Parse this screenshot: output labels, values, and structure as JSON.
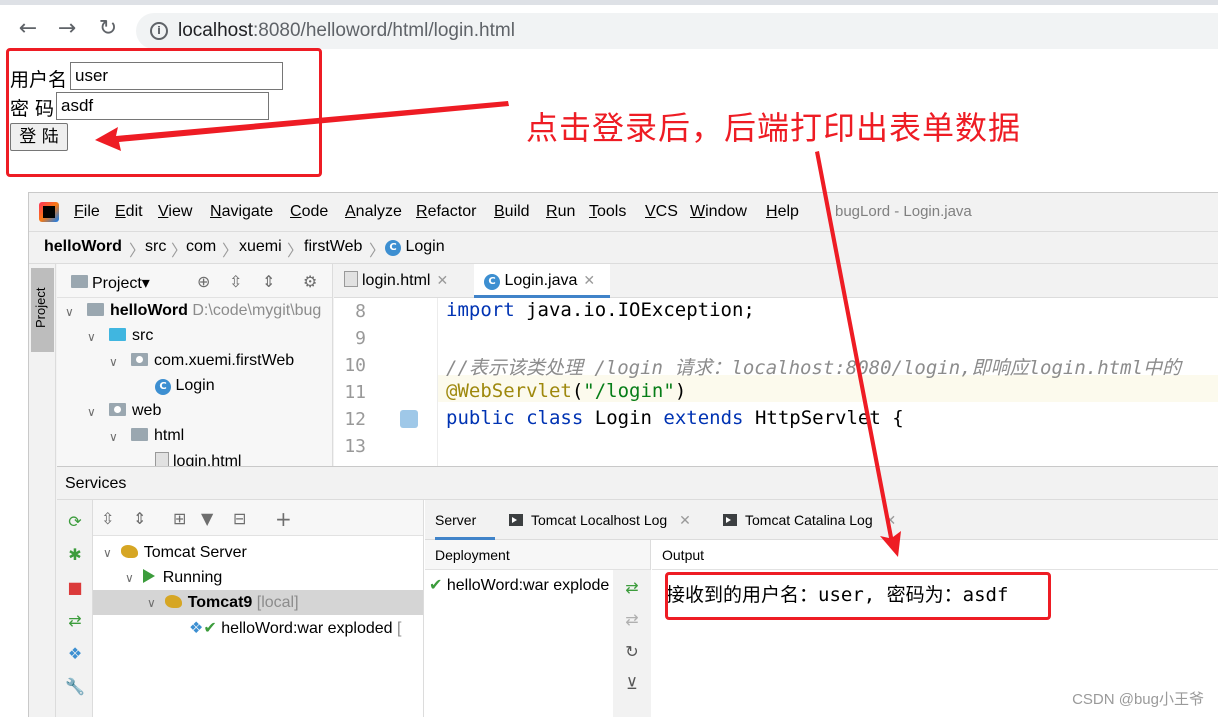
{
  "browser": {
    "url_host": "localhost",
    "url_path": ":8080/helloword/html/login.html",
    "back_icon": "back-arrow-icon",
    "forward_icon": "forward-arrow-icon",
    "reload_icon": "reload-icon"
  },
  "login_form": {
    "username_label": "用户名",
    "username_value": "user",
    "password_label": "密 码",
    "password_value": "asdf",
    "submit_label": "登 陆"
  },
  "annotation": {
    "text": "点击登录后，后端打印出表单数据",
    "color": "#ee1c24"
  },
  "ide": {
    "window_title": "bugLord - Login.java",
    "menu": [
      "File",
      "Edit",
      "View",
      "Navigate",
      "Code",
      "Analyze",
      "Refactor",
      "Build",
      "Run",
      "Tools",
      "VCS",
      "Window",
      "Help"
    ],
    "breadcrumb": [
      "helloWord",
      "src",
      "com",
      "xuemi",
      "firstWeb",
      "Login"
    ],
    "project_panel": {
      "tab_label": "Project",
      "toolbar_label": "Project▾",
      "tree": [
        {
          "label": "helloWord",
          "extra": "D:\\code\\mygit\\bug"
        },
        {
          "label": "src"
        },
        {
          "label": "com.xuemi.firstWeb"
        },
        {
          "label": "Login"
        },
        {
          "label": "web"
        },
        {
          "label": "html"
        },
        {
          "label": "login.html"
        }
      ]
    },
    "editor": {
      "tabs": [
        {
          "label": "login.html"
        },
        {
          "label": "Login.java",
          "active": true
        }
      ],
      "lines": [
        {
          "no": "8",
          "code": "import java.io.IOException;"
        },
        {
          "no": "9",
          "code": ""
        },
        {
          "no": "10",
          "code": "//表示该类处理 /login 请求：localhost:8080/login,即响应login.html中的"
        },
        {
          "no": "11",
          "code": "@WebServlet(\"/login\")"
        },
        {
          "no": "12",
          "code": "public class Login extends HttpServlet {"
        },
        {
          "no": "13",
          "code": ""
        }
      ],
      "code_tokens": {
        "import_kw": "import",
        "import_rest": " java.io.IOException;",
        "comment": "//表示该类处理 /login 请求：localhost:8080/login,即响应login.html中的",
        "annotation": "@WebServlet",
        "ann_open": "(",
        "ann_string": "\"/login\"",
        "ann_close": ")",
        "kw_public": "public",
        "kw_class": "class",
        "class_name": "Login",
        "kw_extends": "extends",
        "super_name": "HttpServlet {"
      }
    },
    "services": {
      "title": "Services",
      "tree": [
        {
          "label": "Tomcat Server"
        },
        {
          "label": "Running"
        },
        {
          "label": "Tomcat9",
          "extra": "[local]",
          "selected": true
        },
        {
          "label": "helloWord:war exploded",
          "extra": "["
        }
      ],
      "tabs": [
        {
          "label": "Server",
          "active": true
        },
        {
          "label": "Tomcat Localhost Log"
        },
        {
          "label": "Tomcat Catalina Log"
        }
      ],
      "deployment_header": "Deployment",
      "deployment_item": "helloWord:war explode",
      "output_header": "Output",
      "output_text": "接收到的用户名：user, 密码为：asdf"
    }
  },
  "watermark": "CSDN @bug小王爷"
}
